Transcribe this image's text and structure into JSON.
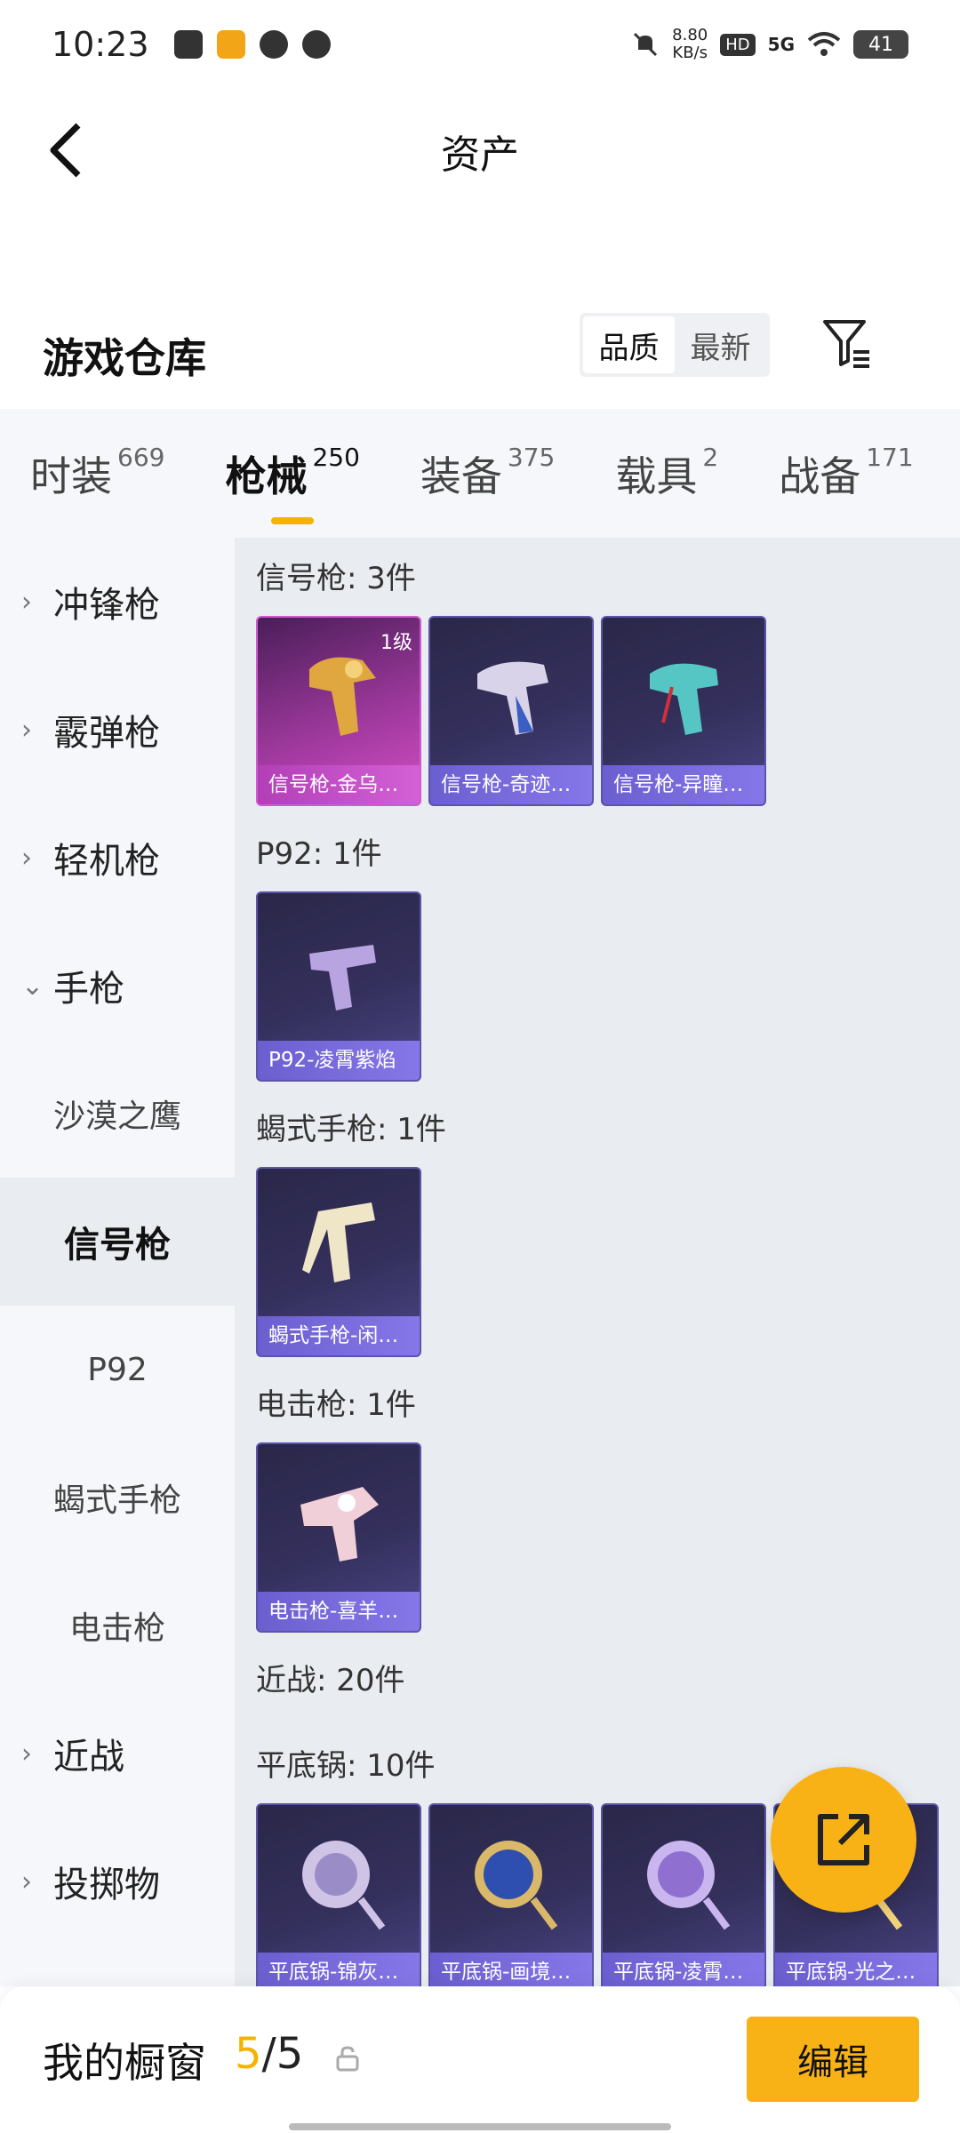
{
  "status_bar": {
    "time": "10:23",
    "net_speed_value": "8.80",
    "net_speed_unit": "KB/s",
    "hd": "HD",
    "signal": "5G",
    "battery": "41"
  },
  "header": {
    "title": "资产"
  },
  "section": {
    "title": "游戏仓库",
    "sort_options": [
      "品质",
      "最新"
    ],
    "sort_selected": "品质"
  },
  "tabs": [
    {
      "label": "时装",
      "count": "669"
    },
    {
      "label": "枪械",
      "count": "250",
      "active": true
    },
    {
      "label": "装备",
      "count": "375"
    },
    {
      "label": "载具",
      "count": "2"
    },
    {
      "label": "战备",
      "count": "171"
    }
  ],
  "sidebar": {
    "items": [
      {
        "label": "冲锋枪",
        "chevron": "›"
      },
      {
        "label": "霰弹枪",
        "chevron": "›"
      },
      {
        "label": "轻机枪",
        "chevron": "›"
      },
      {
        "label": "手枪",
        "chevron": "⌄"
      }
    ],
    "sub_items": [
      {
        "label": "沙漠之鹰"
      },
      {
        "label": "信号枪",
        "active": true
      },
      {
        "label": "P92"
      },
      {
        "label": "蝎式手枪"
      },
      {
        "label": "电击枪"
      }
    ],
    "items_after": [
      {
        "label": "近战",
        "chevron": "›"
      },
      {
        "label": "投掷物",
        "chevron": "›"
      }
    ]
  },
  "groups": {
    "signal_gun": {
      "title": "信号枪: 3件",
      "cards": [
        {
          "name": "信号枪-金乌…",
          "level": "1级",
          "rarity": "gold"
        },
        {
          "name": "信号枪-奇迹…",
          "rarity": "purple"
        },
        {
          "name": "信号枪-异瞳…",
          "rarity": "purple"
        }
      ]
    },
    "p92": {
      "title": "P92: 1件",
      "cards": [
        {
          "name": "P92-凌霄紫焰",
          "rarity": "purple"
        }
      ]
    },
    "scorpion": {
      "title": "蝎式手枪: 1件",
      "cards": [
        {
          "name": "蝎式手枪-闲…",
          "rarity": "purple"
        }
      ]
    },
    "stun_gun": {
      "title": "电击枪: 1件",
      "cards": [
        {
          "name": "电击枪-喜羊…",
          "rarity": "purple"
        }
      ]
    },
    "melee": {
      "title": "近战: 20件"
    },
    "pan": {
      "title": "平底锅: 10件",
      "cards": [
        {
          "name": "平底锅-锦灰…",
          "rarity": "purple"
        },
        {
          "name": "平底锅-画境…",
          "rarity": "purple"
        },
        {
          "name": "平底锅-凌霄…",
          "rarity": "purple"
        },
        {
          "name": "平底锅-光之…",
          "rarity": "purple"
        }
      ]
    }
  },
  "bottom_bar": {
    "label": "我的橱窗",
    "count_current": "5",
    "count_sep": "/",
    "count_max": "5",
    "edit_label": "编辑"
  },
  "colors": {
    "accent": "#f9b215",
    "card_purple": "#5b54a8",
    "card_gold": "#cf5ad0"
  }
}
